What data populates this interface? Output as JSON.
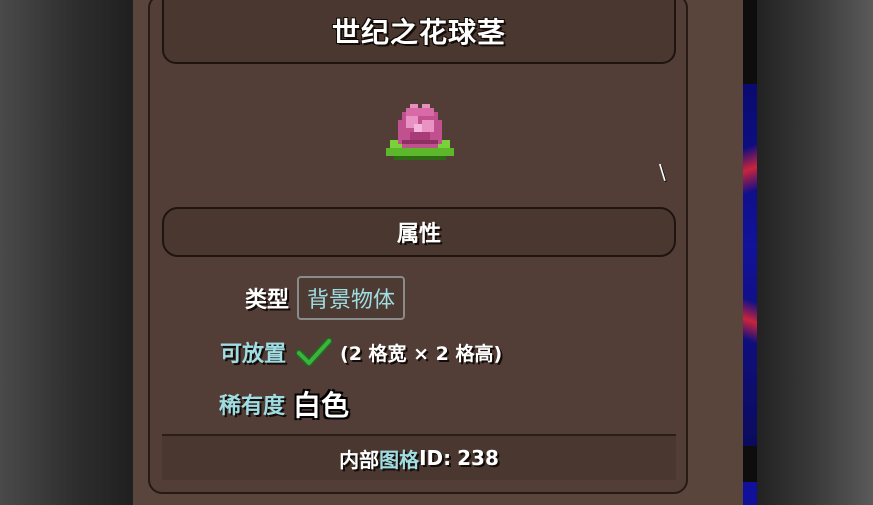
{
  "item": {
    "name": "世纪之花球茎",
    "sprite_icon": "plantera-bulb-icon"
  },
  "cursor_glyph": "\\",
  "sections": {
    "attributes_title": "属性"
  },
  "attributes": {
    "type_label": "类型",
    "type_value": "背景物体",
    "placeable_label": "可放置",
    "placeable_icon": "check-icon",
    "placeable_size": "(2 格宽 × 2 格高)",
    "rarity_label": "稀有度",
    "rarity_value": "白色"
  },
  "footer": {
    "label_a": "内部",
    "label_b": "图格",
    "label_c": " ID:",
    "id_value": "238"
  },
  "colors": {
    "panel": "#5a453d",
    "label_teal": "#9fdde2",
    "check_green": "#3cb33c"
  }
}
